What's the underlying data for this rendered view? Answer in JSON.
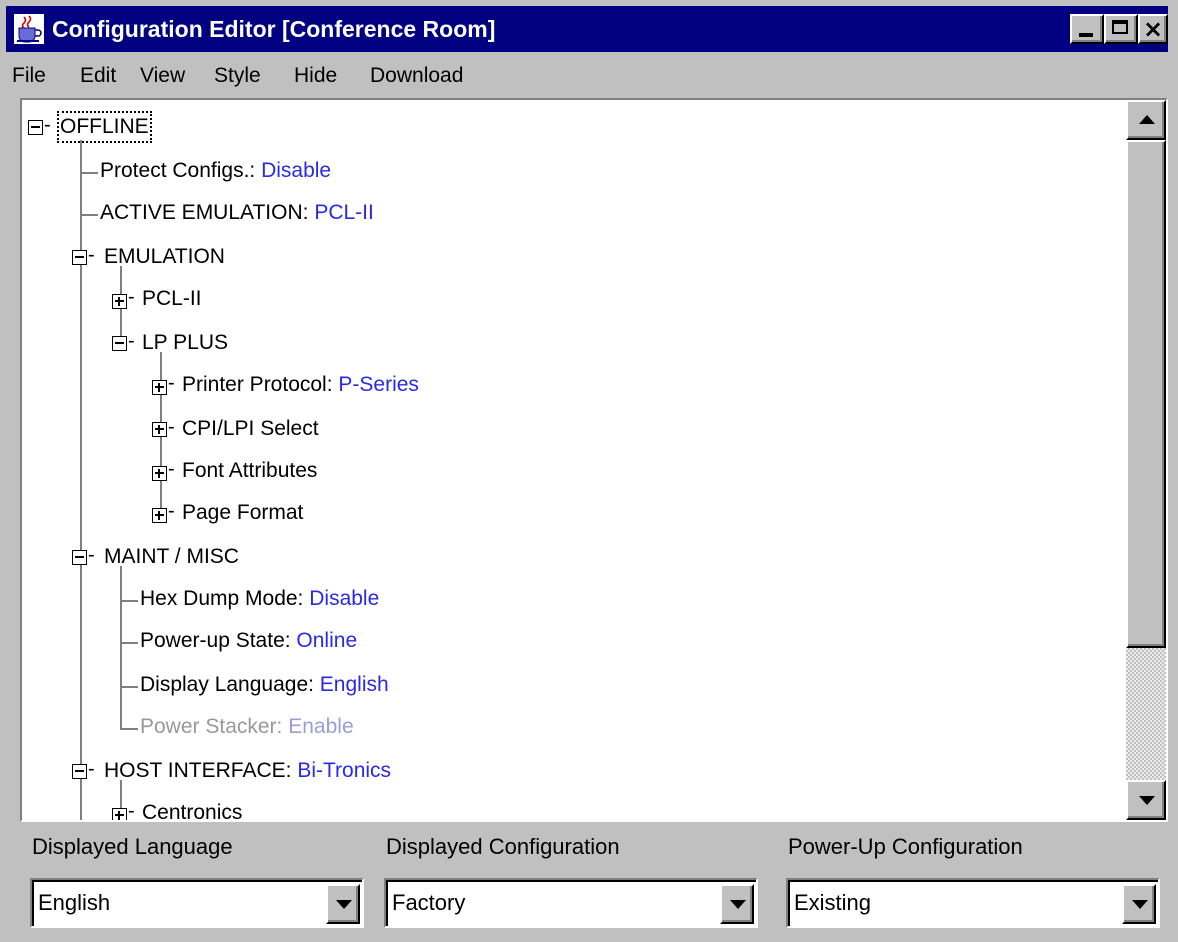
{
  "window": {
    "title": "Configuration Editor [Conference Room]",
    "title_bar_color": "#000080",
    "app_icon": "java-cup-icon"
  },
  "menu": {
    "items": [
      "File",
      "Edit",
      "View",
      "Style",
      "Hide",
      "Download"
    ]
  },
  "tree": {
    "value_color": "#2a2ae6",
    "disabled_color": "#9c9cd8",
    "nodes": [
      {
        "label": "OFFLINE",
        "value": "",
        "state": "expanded"
      },
      {
        "label": "Protect Configs.: ",
        "value": "Disable"
      },
      {
        "label": "ACTIVE EMULATION: ",
        "value": "PCL-II"
      },
      {
        "label": "EMULATION",
        "value": "",
        "state": "expanded"
      },
      {
        "label": "PCL-II",
        "value": "",
        "state": "collapsed"
      },
      {
        "label": "LP PLUS",
        "value": "",
        "state": "expanded"
      },
      {
        "label": "Printer Protocol: ",
        "value": "P-Series",
        "state": "collapsed"
      },
      {
        "label": "CPI/LPI Select",
        "value": "",
        "state": "collapsed"
      },
      {
        "label": "Font Attributes",
        "value": "",
        "state": "collapsed"
      },
      {
        "label": "Page Format",
        "value": "",
        "state": "collapsed"
      },
      {
        "label": "MAINT / MISC",
        "value": "",
        "state": "expanded"
      },
      {
        "label": "Hex Dump Mode: ",
        "value": "Disable"
      },
      {
        "label": "Power-up State: ",
        "value": "Online"
      },
      {
        "label": "Display Language: ",
        "value": "English"
      },
      {
        "label": "Power Stacker: ",
        "value": "Enable",
        "disabled": true
      },
      {
        "label": "HOST INTERFACE: ",
        "value": "Bi-Tronics",
        "state": "expanded"
      },
      {
        "label": "Centronics",
        "value": "",
        "state": "collapsed"
      }
    ]
  },
  "selectors": [
    {
      "label": "Displayed Language",
      "value": "English"
    },
    {
      "label": "Displayed Configuration",
      "value": "Factory"
    },
    {
      "label": "Power-Up Configuration",
      "value": "Existing"
    }
  ]
}
